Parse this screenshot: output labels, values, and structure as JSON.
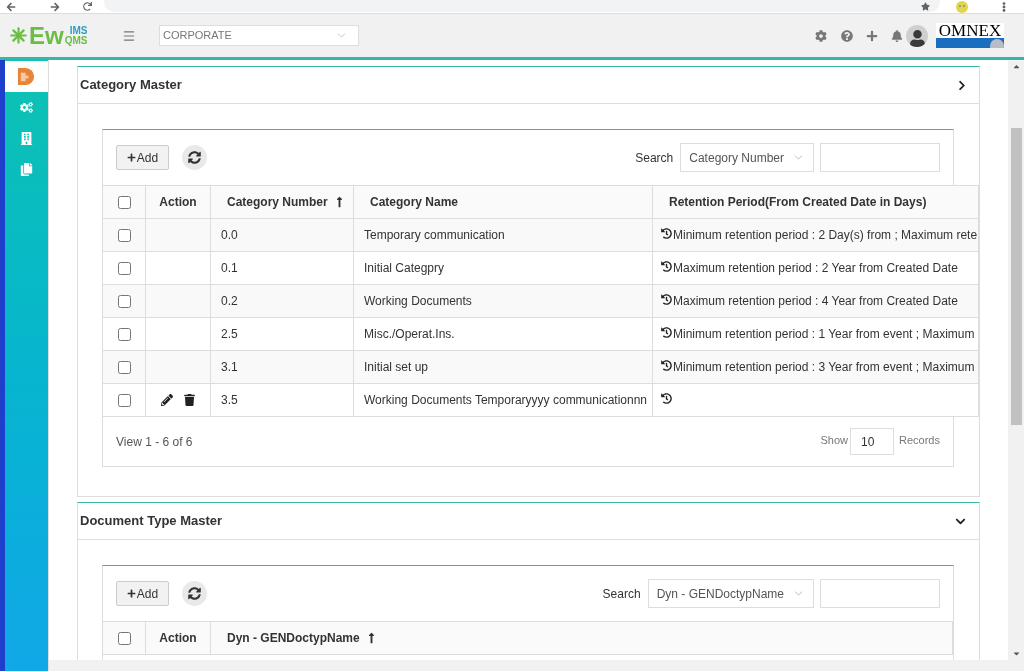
{
  "header": {
    "logo": {
      "text": "Ew",
      "top": "IMS",
      "bottom": "QMS"
    },
    "org_select": {
      "value": "CORPORATE"
    },
    "brand": "OMNEX"
  },
  "sidebar": {
    "items": [
      {
        "selected": true
      },
      {
        "selected": false
      },
      {
        "selected": false
      },
      {
        "selected": false
      }
    ]
  },
  "panels": [
    {
      "title": "Category Master",
      "expanded": false,
      "add_label": "Add",
      "search_label": "Search",
      "search_select": {
        "value": "Category Number"
      },
      "table": {
        "columns": [
          {
            "kind": "checkbox",
            "checked": false
          },
          {
            "label": "Action",
            "kind": "action",
            "sorted": false
          },
          {
            "label": "Category Number",
            "kind": "text",
            "sorted": true
          },
          {
            "label": "Category Name",
            "kind": "text",
            "sorted": false
          },
          {
            "label": "Retention Period(From Created Date in Days)",
            "kind": "retention",
            "sorted": false
          }
        ],
        "rows": [
          {
            "checked": false,
            "editable": false,
            "cells": [
              "",
              "",
              "0.0",
              "Temporary communication",
              "Minimum retention period : 2 Day(s) from ; Maximum rete"
            ]
          },
          {
            "checked": false,
            "editable": false,
            "cells": [
              "",
              "",
              "0.1",
              "Initial Categpry",
              "Maximum retention period : 2 Year from Created Date"
            ]
          },
          {
            "checked": false,
            "editable": false,
            "cells": [
              "",
              "",
              "0.2",
              "Working Documents",
              "Maximum retention period : 4 Year from Created Date"
            ]
          },
          {
            "checked": false,
            "editable": false,
            "cells": [
              "",
              "",
              "2.5",
              "Misc./Operat.Ins.",
              "Minimum retention period : 1 Year from event ; Maximum"
            ]
          },
          {
            "checked": false,
            "editable": false,
            "cells": [
              "",
              "",
              "3.1",
              "Initial set up",
              "Minimum retention period : 3 Year from event ; Maximum"
            ]
          },
          {
            "checked": false,
            "editable": true,
            "cells": [
              "",
              "",
              "3.5",
              "Working Documents Temporaryyyy communicationnn"
            ]
          }
        ]
      },
      "footer": {
        "info": "View 1 - 6 of 6",
        "show_label": "Show",
        "page_size": "10",
        "records_label": "Records"
      }
    },
    {
      "title": "Document Type Master",
      "expanded": true,
      "add_label": "Add",
      "search_label": "Search",
      "search_select": {
        "value": "Dyn - GENDoctypName"
      },
      "table": {
        "columns": [
          {
            "kind": "checkbox",
            "checked": false
          },
          {
            "label": "Action",
            "kind": "action",
            "sorted": false
          },
          {
            "label": "Dyn - GENDoctypName",
            "kind": "text",
            "sorted": true
          }
        ]
      }
    }
  ]
}
